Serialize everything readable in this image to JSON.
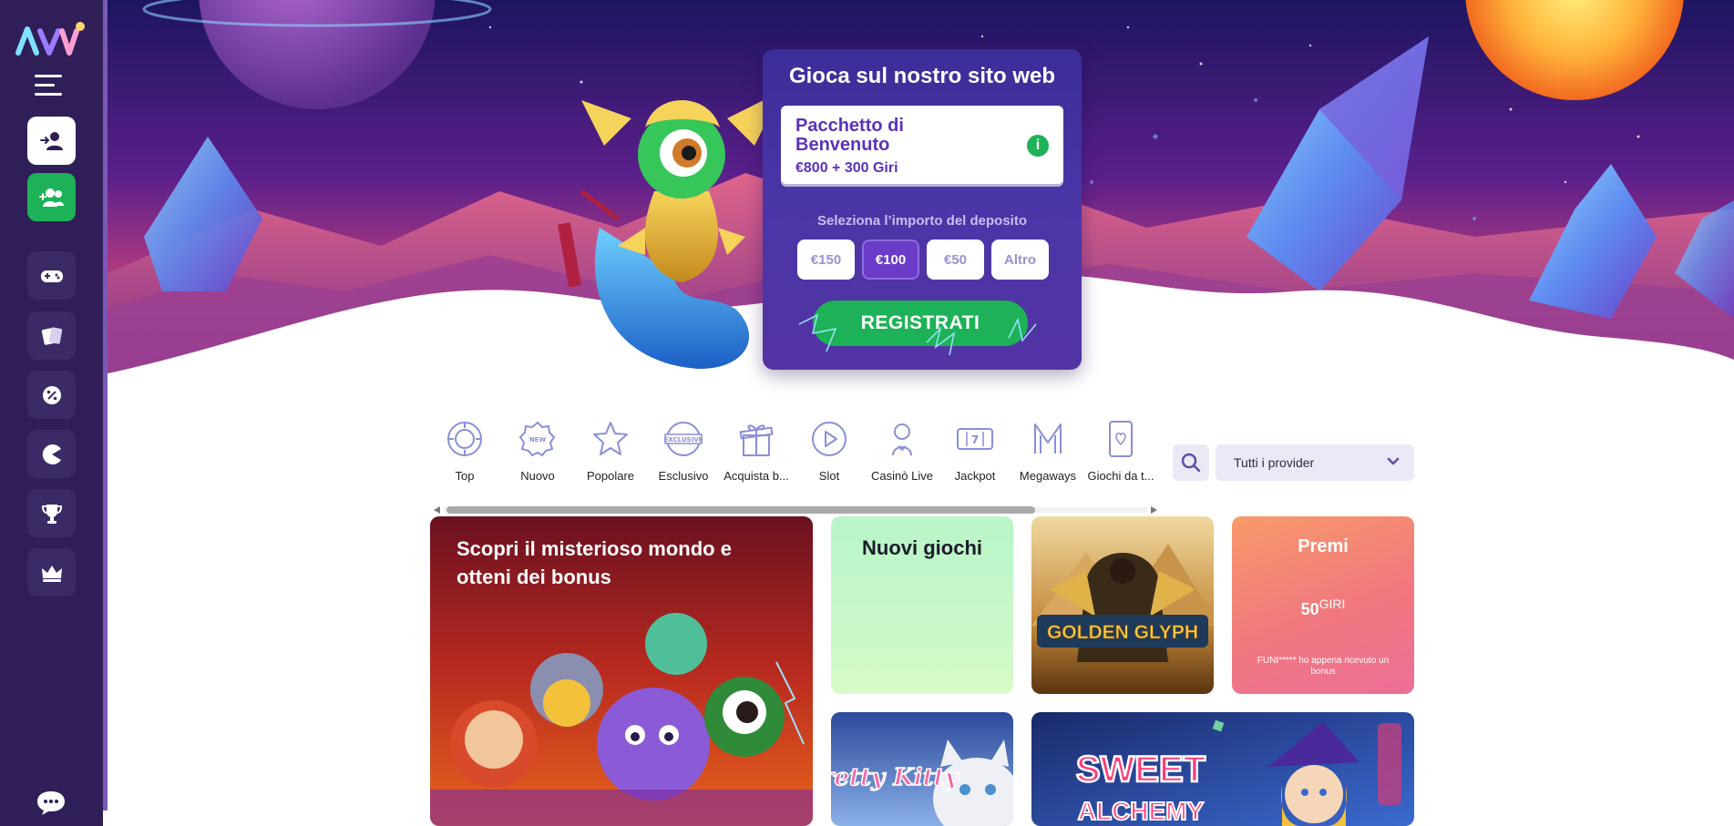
{
  "colors": {
    "sidebar_bg": "#2f1e57",
    "accent_green": "#1db257",
    "accent_purple": "#5a33b8",
    "card_bg": "#4a35a7"
  },
  "sidebar": {
    "logo_icon": "brand-logo-icon",
    "items": [
      {
        "name": "login",
        "icon": "user-login-icon"
      },
      {
        "name": "register",
        "icon": "user-add-icon"
      },
      {
        "name": "games",
        "icon": "gamepad-icon"
      },
      {
        "name": "cards",
        "icon": "cards-icon"
      },
      {
        "name": "promotions",
        "icon": "percent-badge-icon"
      },
      {
        "name": "pacman",
        "icon": "pacman-icon"
      },
      {
        "name": "tournaments",
        "icon": "trophy-icon"
      },
      {
        "name": "vip",
        "icon": "crown-icon"
      }
    ],
    "chat_icon": "chat-icon"
  },
  "signup": {
    "title": "Gioca sul nostro sito web",
    "welcome_title": "Pacchetto di Benvenuto",
    "welcome_amount": "€800 + 300 Giri",
    "deposit_label": "Seleziona l’importo del deposito",
    "amounts": [
      "€150",
      "€100",
      "€50",
      "Altro"
    ],
    "selected_amount": "€100",
    "register_label": "REGISTRATI"
  },
  "categories": [
    {
      "label": "Top",
      "icon": "chip-icon"
    },
    {
      "label": "Nuovo",
      "icon": "new-badge-icon"
    },
    {
      "label": "Popolare",
      "icon": "star-icon"
    },
    {
      "label": "Esclusivo",
      "icon": "exclusive-badge-icon"
    },
    {
      "label": "Acquista b...",
      "icon": "gift-icon"
    },
    {
      "label": "Slot",
      "icon": "play-circle-icon"
    },
    {
      "label": "Casinò Live",
      "icon": "dealer-icon"
    },
    {
      "label": "Jackpot",
      "icon": "slot-777-icon"
    },
    {
      "label": "Megaways",
      "icon": "megaways-m-icon"
    },
    {
      "label": "Giochi da t...",
      "icon": "playing-card-icon"
    }
  ],
  "filters": {
    "search_icon": "search-icon",
    "provider_value": "Tutti i provider",
    "chevron_icon": "chevron-down-icon"
  },
  "tiles": {
    "promo_text": "Scopri il misterioso mondo e otteni dei bonus",
    "new_games": "Nuovi giochi",
    "golden_glyph": "GOLDEN GLYPH",
    "prize_title": "Premi",
    "prize_amount": "50",
    "prize_unit": "GIRI",
    "prize_message": "FUNI***** ho appena ricevuto un bonus",
    "pretty_kitty": "Pretty Kitty",
    "sweet_alchemy_1": "SWEET",
    "sweet_alchemy_2": "ALCHEMY"
  }
}
